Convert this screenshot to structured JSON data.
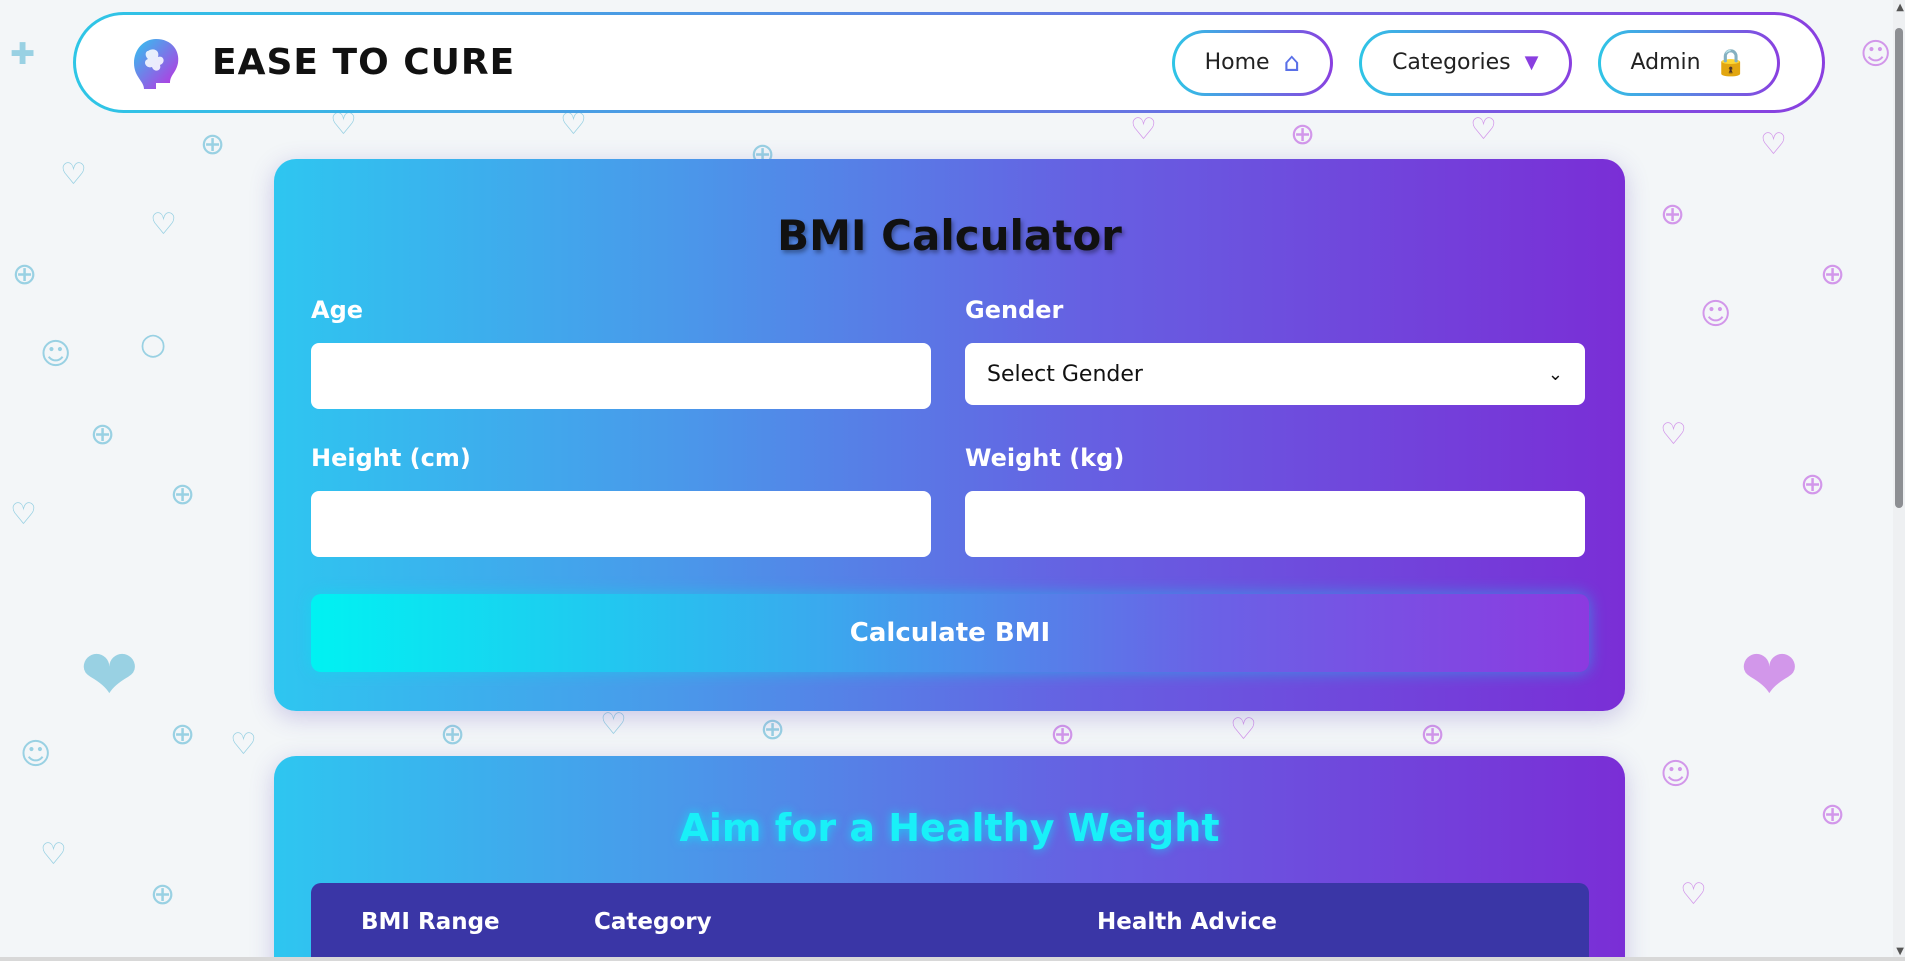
{
  "navbar": {
    "brand": "EASE TO CURE",
    "items": [
      {
        "label": "Home",
        "icon": "home-icon"
      },
      {
        "label": "Categories",
        "icon": "triangle-down-icon"
      },
      {
        "label": "Admin",
        "icon": "lock-icon"
      }
    ]
  },
  "bmi_form": {
    "title": "BMI Calculator",
    "age": {
      "label": "Age",
      "value": "",
      "placeholder": ""
    },
    "gender": {
      "label": "Gender",
      "selected": "Select Gender"
    },
    "height": {
      "label": "Height (cm)",
      "value": "",
      "placeholder": ""
    },
    "weight": {
      "label": "Weight (kg)",
      "value": "",
      "placeholder": ""
    },
    "submit_label": "Calculate BMI"
  },
  "info": {
    "title": "Aim for a Healthy Weight",
    "columns": [
      "BMI Range",
      "Category",
      "Health Advice"
    ]
  },
  "colors": {
    "gradient_start": "#2ec6f0",
    "gradient_end": "#7a2ed6",
    "title_glow": "#19f0f8",
    "table_header": "#3a36a6"
  }
}
